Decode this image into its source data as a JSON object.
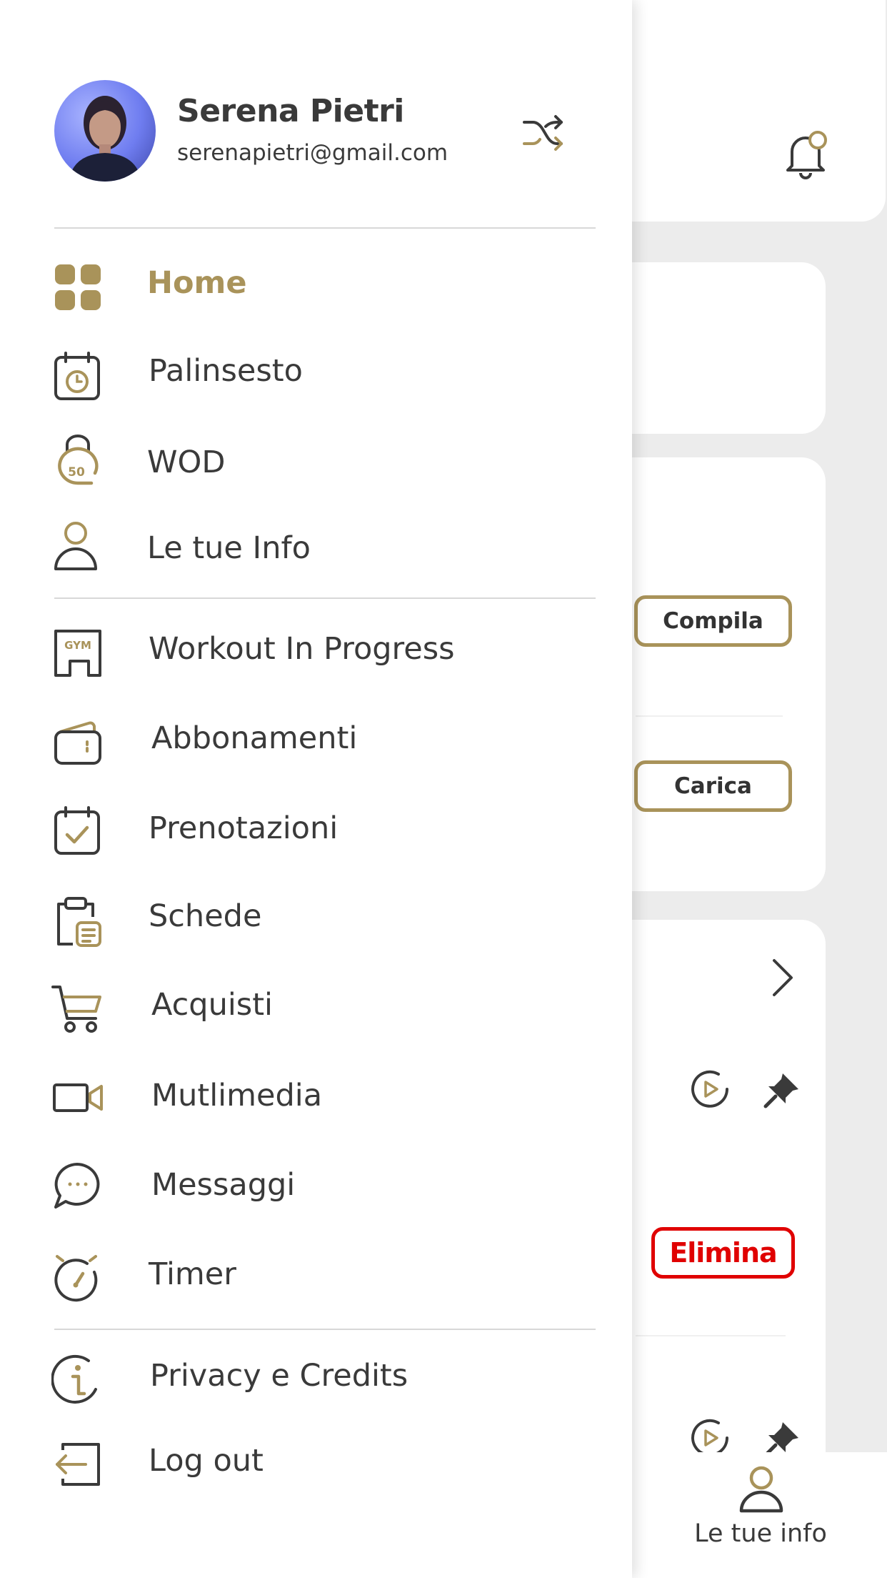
{
  "user": {
    "name": "Serena Pietri",
    "email": "serenapietri@gmail.com"
  },
  "menu": {
    "items": [
      {
        "label": "Home",
        "icon": "home-grid-icon",
        "active": true
      },
      {
        "label": "Palinsesto",
        "icon": "calendar-clock-icon"
      },
      {
        "label": "WOD",
        "icon": "kettlebell-icon"
      },
      {
        "label": "Le tue Info",
        "icon": "user-icon"
      },
      {
        "label": "Workout In Progress",
        "icon": "gym-building-icon"
      },
      {
        "label": "Abbonamenti",
        "icon": "wallet-icon"
      },
      {
        "label": "Prenotazioni",
        "icon": "calendar-check-icon"
      },
      {
        "label": "Schede",
        "icon": "clipboard-icon"
      },
      {
        "label": "Acquisti",
        "icon": "cart-icon"
      },
      {
        "label": "Mutlimedia",
        "icon": "video-camera-icon"
      },
      {
        "label": "Messaggi",
        "icon": "chat-bubble-icon"
      },
      {
        "label": "Timer",
        "icon": "stopwatch-icon"
      },
      {
        "label": "Privacy e Credits",
        "icon": "info-icon"
      },
      {
        "label": "Log out",
        "icon": "logout-icon"
      }
    ]
  },
  "background": {
    "buttons": {
      "compila": "Compila",
      "carica": "Carica",
      "elimina": "Elimina"
    },
    "bottom_tab": {
      "label": "Le tue info"
    }
  },
  "colors": {
    "accent": "#a9935a",
    "text": "#3a3a3a",
    "danger": "#e00000",
    "background": "#ececec"
  }
}
